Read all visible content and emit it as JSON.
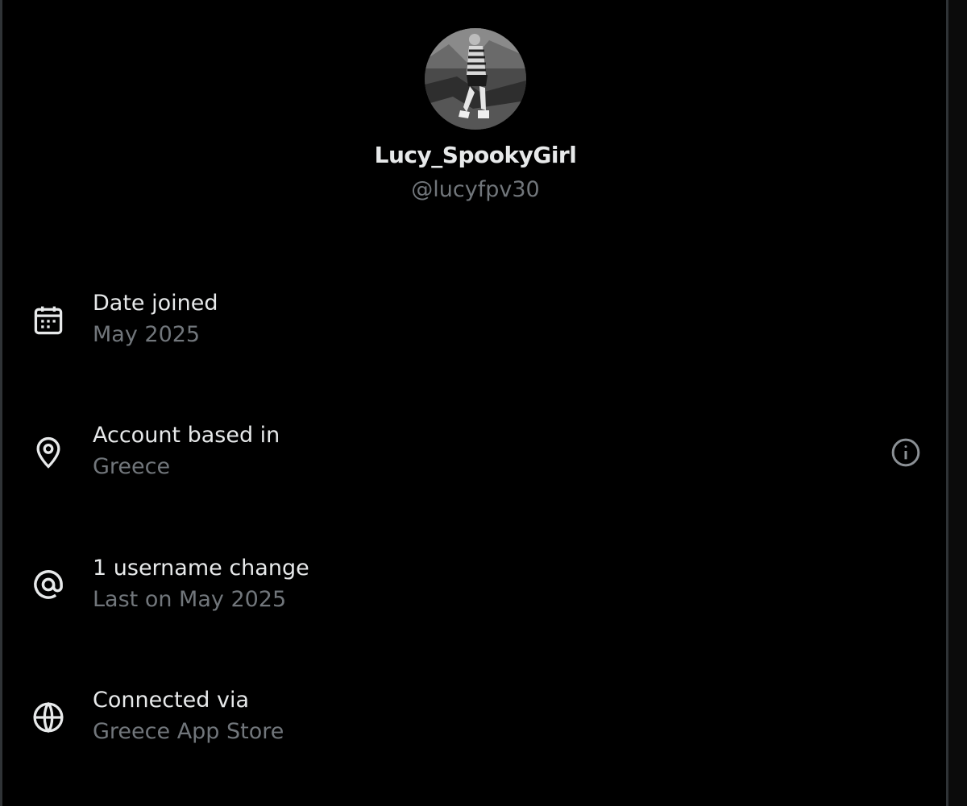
{
  "profile": {
    "display_name": "Lucy_SpookyGirl",
    "handle": "@lucyfpv30"
  },
  "rows": [
    {
      "icon": "calendar-icon",
      "title": "Date joined",
      "subtitle": "May 2025"
    },
    {
      "icon": "location-pin-icon",
      "title": "Account based in",
      "subtitle": "Greece",
      "action_icon": "info-icon"
    },
    {
      "icon": "at-sign-icon",
      "title": "1 username change",
      "subtitle": "Last on May 2025"
    },
    {
      "icon": "globe-icon",
      "title": "Connected via",
      "subtitle": "Greece App Store"
    }
  ],
  "colors": {
    "background": "#000000",
    "primary_text": "#e7e9ea",
    "secondary_text": "#71767b",
    "border": "#2f3336"
  }
}
